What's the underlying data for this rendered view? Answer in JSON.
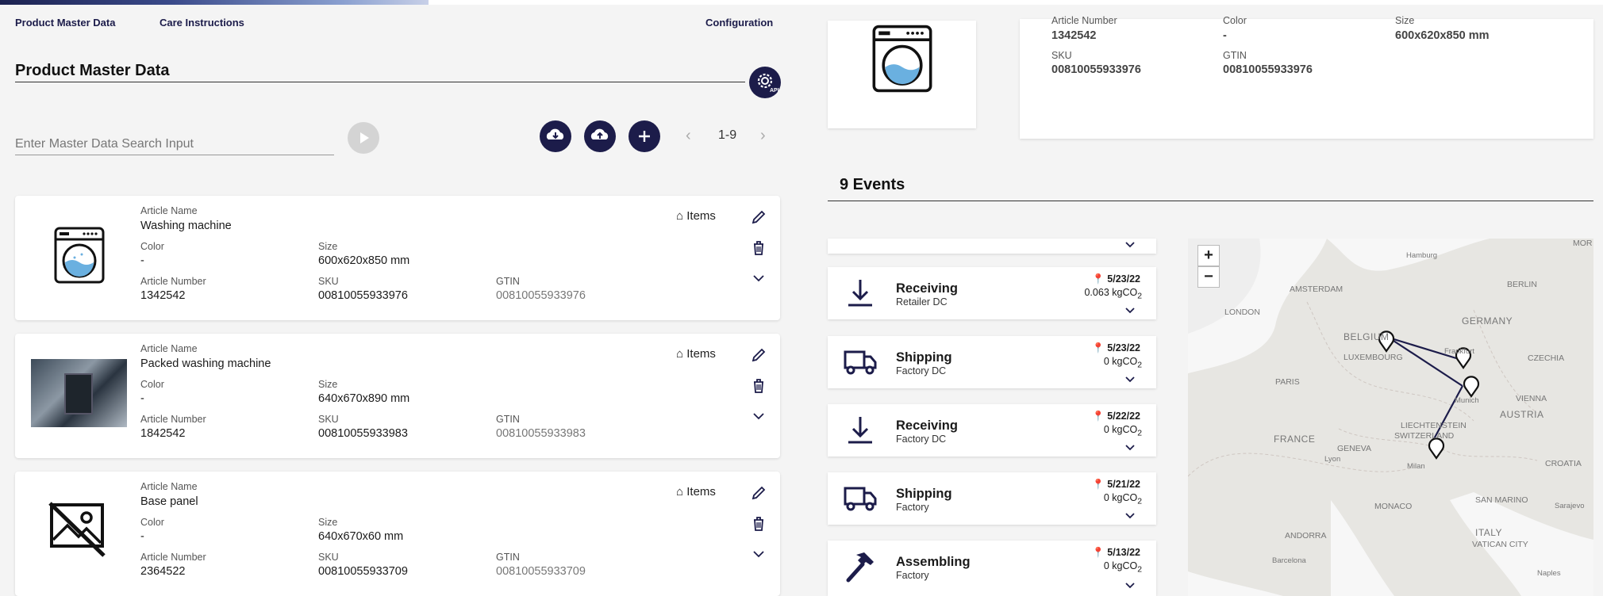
{
  "nav": {
    "master": "Product Master Data",
    "care": "Care Instructions",
    "config": "Configuration"
  },
  "page": {
    "title": "Product Master Data",
    "api_label": "API"
  },
  "search": {
    "placeholder": "Enter Master Data Search Input",
    "value": ""
  },
  "pager": {
    "range": "1-9"
  },
  "labels": {
    "article_name": "Article Name",
    "color": "Color",
    "size": "Size",
    "article_number": "Article Number",
    "sku": "SKU",
    "gtin": "GTIN",
    "items": "Items"
  },
  "products": [
    {
      "name": "Washing machine",
      "color": "-",
      "size": "600x620x850 mm",
      "article_number": "1342542",
      "sku": "00810055933976",
      "gtin": "00810055933976",
      "image": "washing-machine-icon"
    },
    {
      "name": "Packed washing machine",
      "color": "-",
      "size": "640x670x890 mm",
      "article_number": "1842542",
      "sku": "00810055933983",
      "gtin": "00810055933983",
      "image": "photo"
    },
    {
      "name": "Base panel",
      "color": "-",
      "size": "640x670x60 mm",
      "article_number": "2364522",
      "sku": "00810055933709",
      "gtin": "00810055933709",
      "image": "no-image-icon"
    }
  ],
  "detail": {
    "article_number_label": "Article Number",
    "article_number": "1342542",
    "color_label": "Color",
    "color": "-",
    "size_label": "Size",
    "size": "600x620x850 mm",
    "sku_label": "SKU",
    "sku": "00810055933976",
    "gtin_label": "GTIN",
    "gtin": "00810055933976"
  },
  "events": {
    "title": "9 Events",
    "items": [
      {
        "name": "Receiving",
        "sub": "Retailer DC",
        "date": "5/23/22",
        "co2": "0.063 kgCO",
        "icon": "receiving-icon"
      },
      {
        "name": "Shipping",
        "sub": "Factory DC",
        "date": "5/23/22",
        "co2": "0 kgCO",
        "icon": "truck-icon"
      },
      {
        "name": "Receiving",
        "sub": "Factory DC",
        "date": "5/22/22",
        "co2": "0 kgCO",
        "icon": "receiving-icon"
      },
      {
        "name": "Shipping",
        "sub": "Factory",
        "date": "5/21/22",
        "co2": "0 kgCO",
        "icon": "truck-icon"
      },
      {
        "name": "Assembling",
        "sub": "Factory",
        "date": "5/13/22",
        "co2": "0 kgCO",
        "icon": "hammer-icon"
      }
    ],
    "co2_sub": "2"
  },
  "map": {
    "zoom_in": "+",
    "zoom_out": "−",
    "labels": {
      "hamburg": "Hamburg",
      "amsterdam": "AMSTERDAM",
      "berlin": "BERLIN",
      "london": "LONDON",
      "belgium": "BELGIUM",
      "germany": "GERMANY",
      "luxembourg": "LUXEMBOURG",
      "frankfurt": "Frankfurt",
      "czechia": "CZECHIA",
      "paris": "PARIS",
      "munich": "Munich",
      "vienna": "VIENNA",
      "austria": "AUSTRIA",
      "liechtenstein": "LIECHTENSTEIN",
      "france": "FRANCE",
      "switzerland": "SWITZERLAND",
      "geneva": "GENEVA",
      "lyon": "Lyon",
      "milan": "Milan",
      "croatia": "CROATIA",
      "monaco": "MONACO",
      "san_marino": "SAN MARINO",
      "sarajevo": "Sarajevo",
      "andorra": "ANDORRA",
      "italy": "ITALY",
      "vatican": "VATICAN CITY",
      "barcelona": "Barcelona",
      "naples": "Naples",
      "mor": "MOR"
    }
  }
}
